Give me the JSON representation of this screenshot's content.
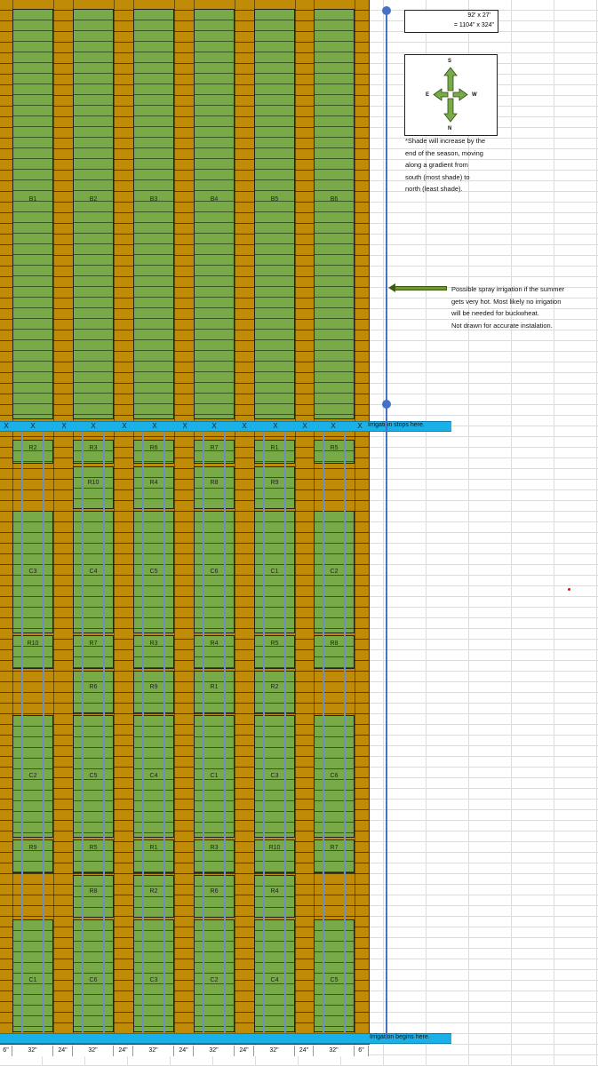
{
  "dimensions_box": {
    "line1": "92' x 27'",
    "line2": "= 1104\" x 324\""
  },
  "compass": {
    "north": "N",
    "south": "S",
    "east": "E",
    "west": "W"
  },
  "shade_note": [
    "*Shade will increase by the",
    "end of the season, moving",
    "along a gradient from",
    "south (most shade) to",
    "north (least shade)."
  ],
  "irrigation_note": [
    "Possible spray irrigation if the summer",
    "gets very hot. Most likely no irrigation",
    "will be needed for buckwheat.",
    "Not drawn for accurate instalation."
  ],
  "irrigation_stops": "Irrigation stops here.",
  "irrigation_begins": "Irrigation begins here.",
  "x_marker": "X",
  "buckwheat_beds": [
    "B1",
    "B2",
    "B3",
    "B4",
    "B5",
    "B6"
  ],
  "lower_blocks": [
    [
      [
        "R2",
        "C3",
        "R10",
        "C2",
        "R9",
        "C1"
      ]
    ],
    [
      [
        "R3",
        "R10",
        "C4",
        "R7",
        "R6",
        "C5",
        "R5",
        "R8",
        "C6"
      ]
    ]
  ],
  "columns": [
    {
      "r_top": [
        "R2",
        ""
      ],
      "c1": "C3",
      "r_mid": [
        "R10",
        ""
      ],
      "c2": "C2",
      "r_low": [
        "R9",
        ""
      ],
      "c3": "C1"
    },
    {
      "r_top": [
        "R3",
        "R10"
      ],
      "c1": "C4",
      "r_mid": [
        "R7",
        "R6"
      ],
      "c2": "C5",
      "r_low": [
        "R5",
        "R8"
      ],
      "c3": "C6"
    },
    {
      "r_top": [
        "R6",
        "R4"
      ],
      "c1": "C5",
      "r_mid": [
        "R3",
        "R9"
      ],
      "c2": "C4",
      "r_low": [
        "R1",
        "R2"
      ],
      "c3": "C3"
    },
    {
      "r_top": [
        "R7",
        "R8"
      ],
      "c1": "C6",
      "r_mid": [
        "R4",
        "R1"
      ],
      "c2": "C1",
      "r_low": [
        "R3",
        "R6"
      ],
      "c3": "C2"
    },
    {
      "r_top": [
        "R1",
        "R9"
      ],
      "c1": "C1",
      "r_mid": [
        "R5",
        "R2"
      ],
      "c2": "C3",
      "r_low": [
        "R10",
        "R4"
      ],
      "c3": "C4"
    },
    {
      "r_top": [
        "R5",
        ""
      ],
      "c1": "C2",
      "r_mid": [
        "R8",
        ""
      ],
      "c2": "C6",
      "r_low": [
        "R7",
        ""
      ],
      "c3": "C5"
    }
  ],
  "dimension_labels": [
    "6\"",
    "32\"",
    "24\"",
    "32\"",
    "24\"",
    "32\"",
    "24\"",
    "32\"",
    "24\"",
    "32\"",
    "24\"",
    "32\"",
    "6\""
  ],
  "colors": {
    "path": "#c08c08",
    "bed": "#78ab48",
    "irrigation_bar": "#1ab0e8",
    "pipe": "#4472c4",
    "arrow": "#6b9a2d"
  }
}
